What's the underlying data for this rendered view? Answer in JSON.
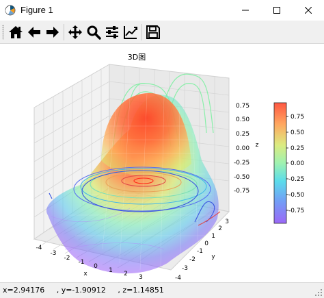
{
  "window": {
    "title": "Figure 1",
    "controls": [
      "minimize",
      "maximize",
      "close"
    ]
  },
  "toolbar": {
    "tools": [
      {
        "name": "home",
        "icon": "home-icon",
        "tooltip": "Reset original view"
      },
      {
        "name": "back",
        "icon": "arrow-left-icon",
        "tooltip": "Back to previous view"
      },
      {
        "name": "forward",
        "icon": "arrow-right-icon",
        "tooltip": "Forward to next view"
      },
      {
        "name": "pan",
        "icon": "move-icon",
        "tooltip": "Pan axes"
      },
      {
        "name": "zoom",
        "icon": "magnifier-icon",
        "tooltip": "Zoom to rectangle"
      },
      {
        "name": "subplots",
        "icon": "sliders-icon",
        "tooltip": "Configure subplots"
      },
      {
        "name": "edit",
        "icon": "line-chart-icon",
        "tooltip": "Edit axis, curve and image parameters"
      },
      {
        "name": "save",
        "icon": "floppy-disk-icon",
        "tooltip": "Save the figure"
      }
    ]
  },
  "plot": {
    "title": "3D图",
    "x_label": "x",
    "y_label": "y",
    "z_label": "z",
    "x_ticks": [
      "-4",
      "-3",
      "-2",
      "-1",
      "0",
      "1",
      "2",
      "3"
    ],
    "y_ticks": [
      "-4",
      "-3",
      "-2",
      "-1",
      "0",
      "1",
      "2",
      "3"
    ],
    "z_ticks": [
      "0.75",
      "0.50",
      "0.25",
      "0.00",
      "-0.25",
      "-0.50",
      "-0.75"
    ],
    "colorbar_ticks": [
      "0.75",
      "0.50",
      "0.25",
      "0.00",
      "-0.25",
      "-0.50",
      "-0.75"
    ],
    "colormap": "rainbow"
  },
  "chart_data": {
    "type": "surface",
    "title": "3D图",
    "xlabel": "x",
    "ylabel": "y",
    "zlabel": "z",
    "xlim": [
      -4,
      4
    ],
    "ylim": [
      -4,
      4
    ],
    "zlim": [
      -1,
      1
    ],
    "function": "z = sin(sqrt(x^2 + y^2))",
    "overlays": [
      "contour on z-plane",
      "contour projections on x and y walls"
    ],
    "colorbar_range": [
      -0.9,
      0.9
    ]
  },
  "status": {
    "coordinates": "x=2.94176     , y=-1.90912     , z=1.14851"
  }
}
